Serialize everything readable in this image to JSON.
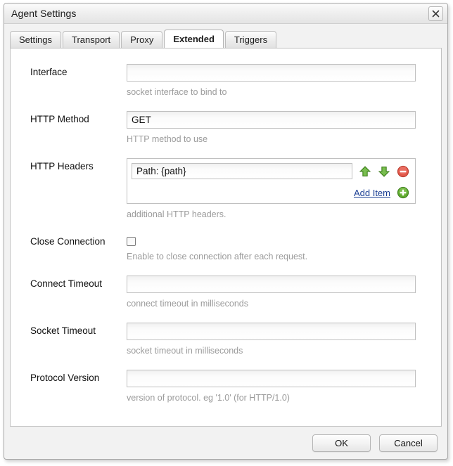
{
  "window": {
    "title": "Agent Settings",
    "close_icon": "close-icon"
  },
  "tabs": [
    {
      "label": "Settings",
      "active": false
    },
    {
      "label": "Transport",
      "active": false
    },
    {
      "label": "Proxy",
      "active": false
    },
    {
      "label": "Extended",
      "active": true
    },
    {
      "label": "Triggers",
      "active": false
    }
  ],
  "fields": {
    "interface": {
      "label": "Interface",
      "value": "",
      "description": "socket interface to bind to"
    },
    "http_method": {
      "label": "HTTP Method",
      "value": "GET",
      "description": "HTTP method to use"
    },
    "http_headers": {
      "label": "HTTP Headers",
      "description": "additional HTTP headers.",
      "items": [
        {
          "value": "Path: {path}"
        }
      ],
      "add_label": "Add Item",
      "icons": {
        "move_up": "arrow-up-icon",
        "move_down": "arrow-down-icon",
        "remove": "remove-circle-icon",
        "add": "add-circle-icon"
      }
    },
    "close_connection": {
      "label": "Close Connection",
      "checked": false,
      "description": "Enable to close connection after each request."
    },
    "connect_timeout": {
      "label": "Connect Timeout",
      "value": "",
      "description": "connect timeout in milliseconds"
    },
    "socket_timeout": {
      "label": "Socket Timeout",
      "value": "",
      "description": "socket timeout in milliseconds"
    },
    "protocol_version": {
      "label": "Protocol Version",
      "value": "",
      "description": "version of protocol. eg '1.0' (for HTTP/1.0)"
    }
  },
  "buttons": {
    "ok": "OK",
    "cancel": "Cancel"
  },
  "colors": {
    "link": "#1b3f94",
    "description": "#9b9b9b",
    "add_green": "#5faa2e",
    "remove_red": "#e05a4c",
    "dialog_bg": "#f2f2f2"
  }
}
